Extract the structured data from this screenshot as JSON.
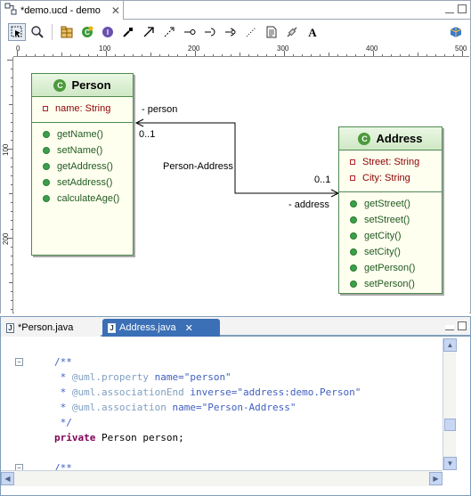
{
  "top_editor": {
    "tab_label": "*demo.ucd - demo",
    "toolbar_icons": [
      "select-tool-icon",
      "zoom-icon",
      "package-icon",
      "class-icon",
      "interface-icon",
      "note-icon",
      "association-icon",
      "dependency-icon",
      "lollipop-icon",
      "required-interface-icon",
      "realization-icon",
      "note-link-icon",
      "text-note-icon",
      "link-icon",
      "text-icon",
      "export-icon"
    ],
    "ruler": {
      "h_labels": [
        "0",
        "100",
        "200",
        "300",
        "400",
        "500"
      ],
      "v_labels": [
        "100",
        "200"
      ]
    }
  },
  "diagram": {
    "person_class": {
      "name": "Person",
      "icon_letter": "C",
      "attributes": [
        "name: String"
      ],
      "operations": [
        "getName()",
        "setName()",
        "getAddress()",
        "setAddress()",
        "calculateAge()"
      ]
    },
    "address_class": {
      "name": "Address",
      "icon_letter": "C",
      "attributes": [
        "Street: String",
        "City: String"
      ],
      "operations": [
        "getStreet()",
        "setStreet()",
        "getCity()",
        "setCity()",
        "getPerson()",
        "setPerson()"
      ]
    },
    "association": {
      "name": "Person-Address",
      "end_person_role": "- person",
      "end_person_mult": "0..1",
      "end_address_role": "- address",
      "end_address_mult": "0..1"
    }
  },
  "bottom_editor": {
    "tabs": [
      {
        "label": "*Person.java",
        "active": false
      },
      {
        "label": "Address.java",
        "active": true
      }
    ],
    "code_lines": [
      [
        {
          "t": "/**",
          "c": "comment"
        }
      ],
      [
        {
          "t": " * ",
          "c": "comment"
        },
        {
          "t": "@uml.property",
          "c": "tag"
        },
        {
          "t": " name=\"person\"",
          "c": "comment"
        }
      ],
      [
        {
          "t": " * ",
          "c": "comment"
        },
        {
          "t": "@uml.associationEnd",
          "c": "tag"
        },
        {
          "t": " inverse=\"address:demo.Person\"",
          "c": "comment"
        }
      ],
      [
        {
          "t": " * ",
          "c": "comment"
        },
        {
          "t": "@uml.association",
          "c": "tag"
        },
        {
          "t": " name=\"Person-Address\"",
          "c": "comment"
        }
      ],
      [
        {
          "t": " */",
          "c": "comment"
        }
      ],
      [
        {
          "t": "private",
          "c": "kw"
        },
        {
          "t": " Person person;",
          "c": "plain"
        }
      ],
      [
        {
          "t": "",
          "c": "plain"
        }
      ],
      [
        {
          "t": "/**",
          "c": "comment"
        }
      ]
    ]
  },
  "colors": {
    "class_border": "#4f8a4f",
    "class_fill": "#fffff0",
    "attr_color": "#8b0000",
    "op_color": "#205a20",
    "javadoc": "#3f5fbf",
    "keyword": "#7f0055",
    "active_tab": "#3b6fb6"
  }
}
